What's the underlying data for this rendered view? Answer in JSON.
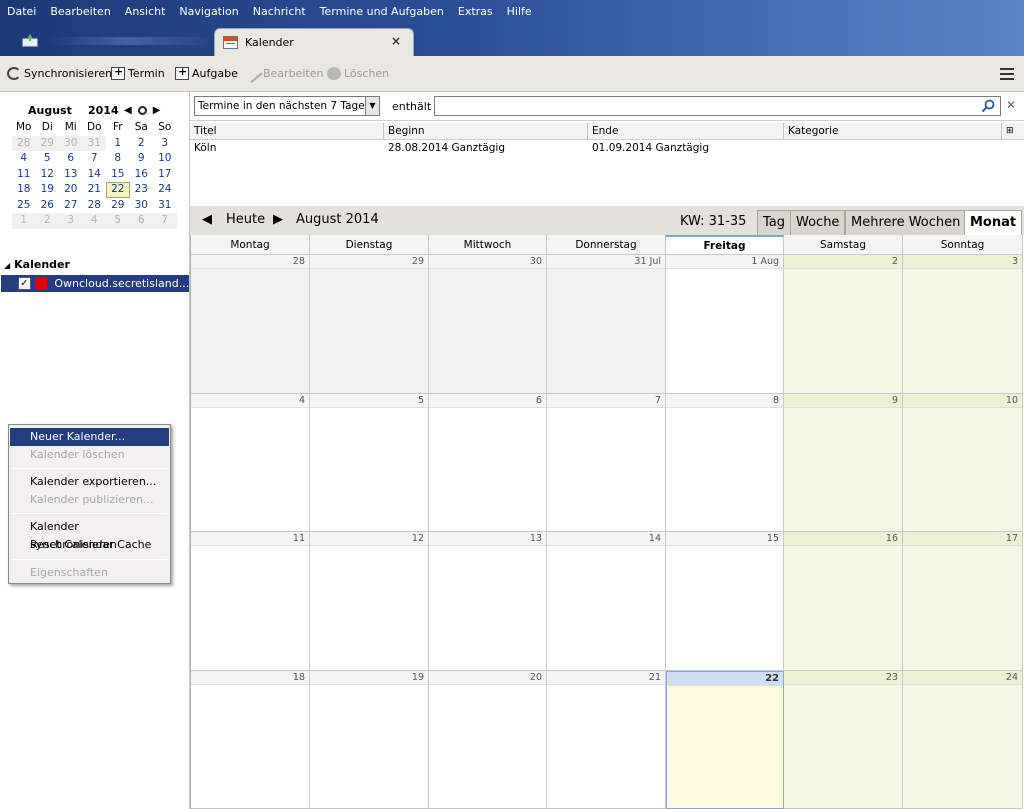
{
  "menu": [
    "Datei",
    "Bearbeiten",
    "Ansicht",
    "Navigation",
    "Nachricht",
    "Termine und Aufgaben",
    "Extras",
    "Hilfe"
  ],
  "tabs": {
    "active_label": "Kalender",
    "close_glyph": "×"
  },
  "toolbar": {
    "sync": "Synchronisieren",
    "event": "Termin",
    "task": "Aufgabe",
    "edit": "Bearbeiten",
    "delete": "Löschen"
  },
  "minical": {
    "month": "August",
    "year": "2014",
    "weekdays": [
      "Mo",
      "Di",
      "Mi",
      "Do",
      "Fr",
      "Sa",
      "So"
    ],
    "weeks": [
      [
        "28",
        "29",
        "30",
        "31",
        "1",
        "2",
        "3"
      ],
      [
        "4",
        "5",
        "6",
        "7",
        "8",
        "9",
        "10"
      ],
      [
        "11",
        "12",
        "13",
        "14",
        "15",
        "16",
        "17"
      ],
      [
        "18",
        "19",
        "20",
        "21",
        "22",
        "23",
        "24"
      ],
      [
        "25",
        "26",
        "27",
        "28",
        "29",
        "30",
        "31"
      ],
      [
        "1",
        "2",
        "3",
        "4",
        "5",
        "6",
        "7"
      ]
    ],
    "today": "22"
  },
  "calendars": {
    "header": "Kalender",
    "items": [
      {
        "name": "Owncloud.secretisland....",
        "color": "#e20000",
        "checked": true
      }
    ]
  },
  "context_menu": {
    "items": [
      {
        "label": "Neuer Kalender...",
        "state": "highlighted"
      },
      {
        "label": "Kalender löschen",
        "state": "disabled"
      },
      {
        "label": "Kalender exportieren...",
        "state": "enabled"
      },
      {
        "label": "Kalender publizieren...",
        "state": "disabled"
      },
      {
        "label": "Kalender synchronisieren",
        "state": "enabled"
      },
      {
        "label": "Reset Calendar Cache",
        "state": "enabled"
      },
      {
        "label": "Eigenschaften",
        "state": "disabled"
      }
    ]
  },
  "filter": {
    "selected": "Termine in den nächsten 7 Tagen",
    "contains_label": "enthält",
    "search_value": ""
  },
  "event_list": {
    "columns": [
      "Titel",
      "Beginn",
      "Ende",
      "Kategorie"
    ],
    "rows": [
      [
        "Köln",
        "28.08.2014 Ganztägig",
        "01.09.2014 Ganztägig",
        ""
      ]
    ]
  },
  "nav": {
    "today": "Heute",
    "period": "August 2014",
    "week_range": "KW: 31-35",
    "views": [
      "Tag",
      "Woche",
      "Mehrere Wochen",
      "Monat"
    ],
    "selected_view": "Monat"
  },
  "month_view": {
    "weekdays": [
      "Montag",
      "Dienstag",
      "Mittwoch",
      "Donnerstag",
      "Freitag",
      "Samstag",
      "Sonntag"
    ],
    "weeks": [
      [
        "28",
        "29",
        "30",
        "31 Jul",
        "1 Aug",
        "2",
        "3"
      ],
      [
        "4",
        "5",
        "6",
        "7",
        "8",
        "9",
        "10"
      ],
      [
        "11",
        "12",
        "13",
        "14",
        "15",
        "16",
        "17"
      ],
      [
        "18",
        "19",
        "20",
        "21",
        "22",
        "23",
        "24"
      ]
    ],
    "today": "22"
  },
  "colors": {
    "selection": "#233d80",
    "weekend": "#f3f8e4",
    "today": "#fdfbdc",
    "calendar": "#e20000"
  }
}
